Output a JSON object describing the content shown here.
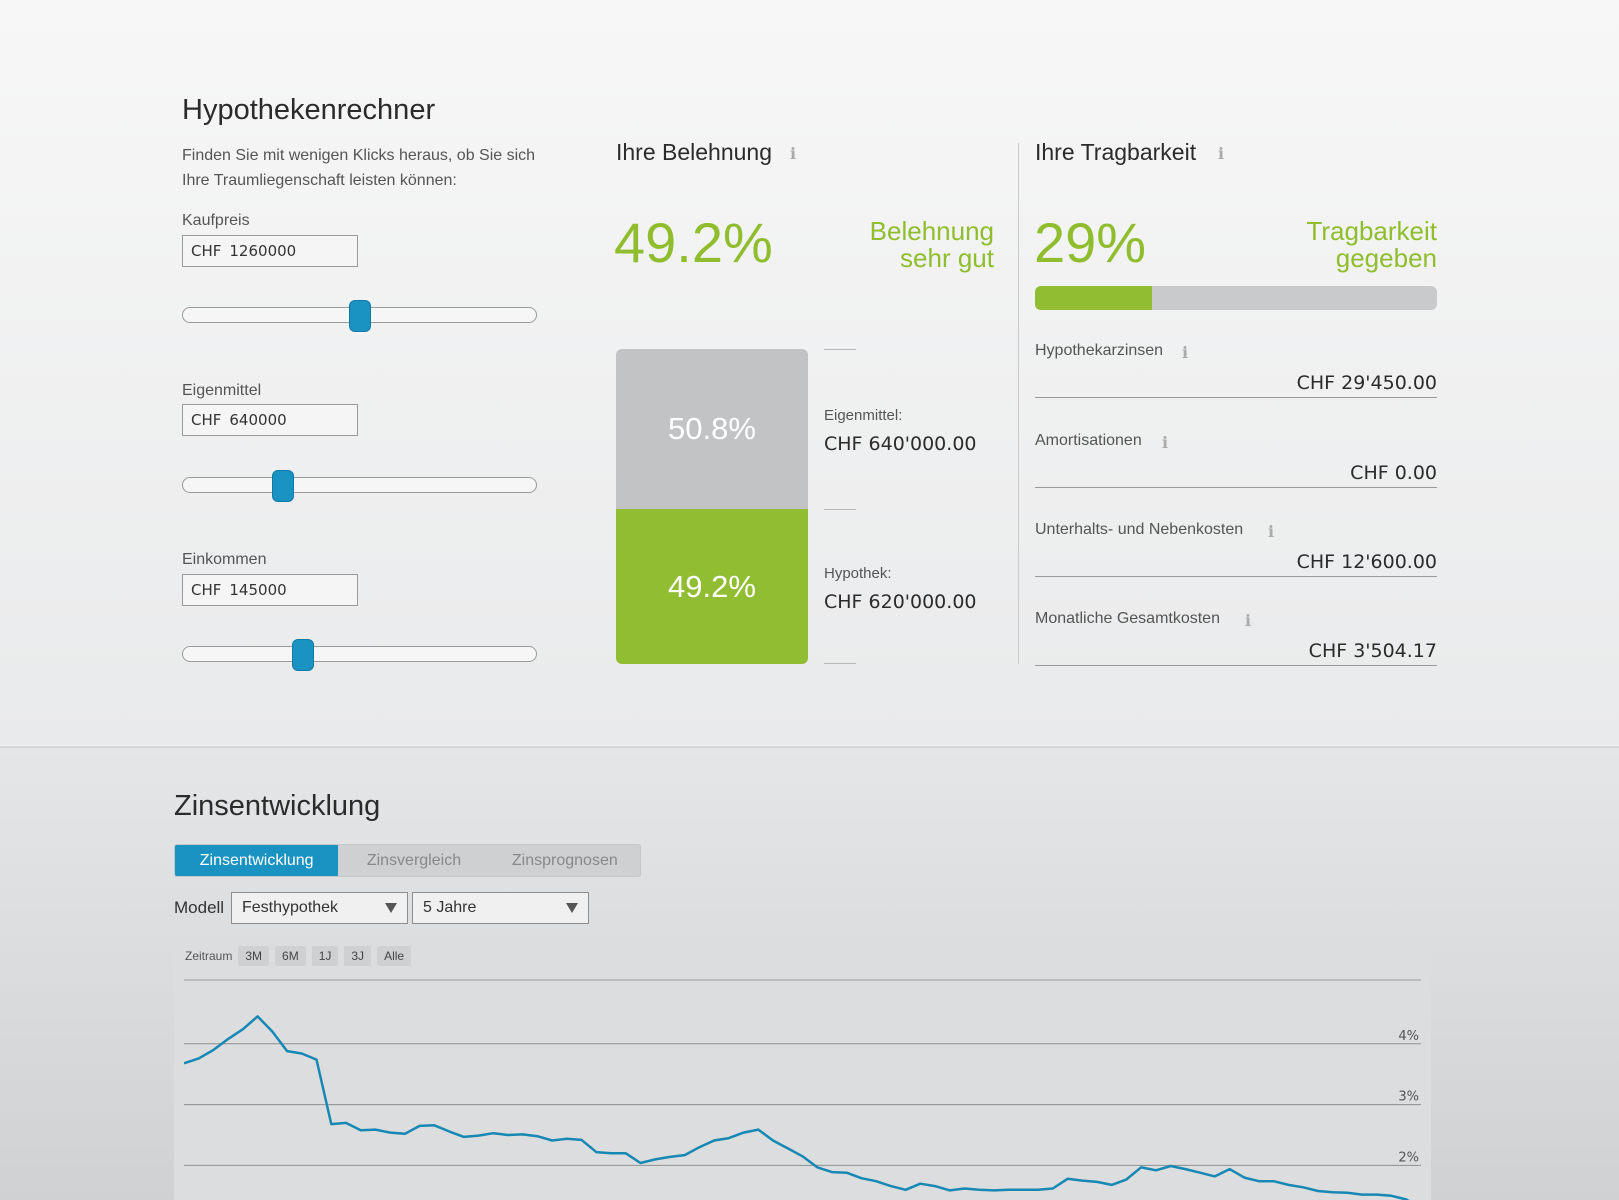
{
  "calculator": {
    "title": "Hypothekenrechner",
    "intro": "Finden Sie mit wenigen Klicks heraus, ob Sie sich Ihre Traumliegenschaft leisten können:",
    "fields": [
      {
        "label": "Kaufpreis",
        "currency": "CHF",
        "value": "1260000",
        "slider_fraction": 0.5
      },
      {
        "label": "Eigenmittel",
        "currency": "CHF",
        "value": "640000",
        "slider_fraction": 0.27
      },
      {
        "label": "Einkommen",
        "currency": "CHF",
        "value": "145000",
        "slider_fraction": 0.33
      }
    ]
  },
  "belehnung": {
    "title": "Ihre Belehnung",
    "info_icon": "i",
    "percent": "49.2%",
    "verdict_line1": "Belehnung",
    "verdict_line2": "sehr gut",
    "equity_share_label": "50.8%",
    "mortgage_share_label": "49.2%",
    "equity_share": 0.508,
    "mortgage_share": 0.492,
    "equity_label": "Eigenmittel:",
    "equity_value": "CHF 640'000.00",
    "mortgage_label": "Hypothek:",
    "mortgage_value": "CHF 620'000.00"
  },
  "tragbarkeit": {
    "title": "Ihre Tragbarkeit",
    "info_icon": "i",
    "percent": "29%",
    "progress_fraction": 0.29,
    "verdict_line1": "Tragbarkeit",
    "verdict_line2": "gegeben",
    "costs": [
      {
        "label": "Hypothekarzinsen",
        "value": "CHF 29'450.00"
      },
      {
        "label": "Amortisationen",
        "value": "CHF 0.00"
      },
      {
        "label": "Unterhalts- und Nebenkosten",
        "value": "CHF 12'600.00"
      },
      {
        "label": "Monatliche Gesamtkosten",
        "value": "CHF 3'504.17"
      }
    ]
  },
  "zins": {
    "title": "Zinsentwicklung",
    "tabs": [
      "Zinsentwicklung",
      "Zinsvergleich",
      "Zinsprognosen"
    ],
    "active_tab": 0,
    "model_label": "Modell",
    "model_value": "Festhypothek",
    "term_value": "5 Jahre",
    "range_label": "Zeitraum",
    "range_buttons": [
      "3M",
      "6M",
      "1J",
      "3J",
      "Alle"
    ]
  },
  "colors": {
    "green": "#8fbd2e",
    "blue": "#1a92c2",
    "gray": "#c2c3c5"
  },
  "chart_data": {
    "type": "line",
    "title": "",
    "xlabel": "",
    "ylabel": "",
    "y_ticks": [
      "4%",
      "3%",
      "2%"
    ],
    "ylim": [
      1.3,
      5.0
    ],
    "series": [
      {
        "values": [
          3.68,
          3.76,
          3.9,
          4.08,
          4.24,
          4.45,
          4.2,
          3.88,
          3.84,
          3.74,
          2.68,
          2.7,
          2.58,
          2.59,
          2.54,
          2.52,
          2.65,
          2.66,
          2.56,
          2.47,
          2.49,
          2.53,
          2.5,
          2.51,
          2.48,
          2.41,
          2.44,
          2.42,
          2.22,
          2.2,
          2.2,
          2.04,
          2.1,
          2.14,
          2.17,
          2.3,
          2.41,
          2.45,
          2.54,
          2.59,
          2.41,
          2.28,
          2.15,
          1.97,
          1.89,
          1.88,
          1.79,
          1.74,
          1.66,
          1.6,
          1.7,
          1.66,
          1.59,
          1.62,
          1.6,
          1.59,
          1.6,
          1.6,
          1.6,
          1.62,
          1.78,
          1.75,
          1.73,
          1.68,
          1.77,
          1.97,
          1.92,
          1.99,
          1.94,
          1.88,
          1.82,
          1.94,
          1.8,
          1.74,
          1.74,
          1.68,
          1.64,
          1.58,
          1.56,
          1.55,
          1.52,
          1.52,
          1.5,
          1.44,
          1.3
        ]
      }
    ]
  }
}
